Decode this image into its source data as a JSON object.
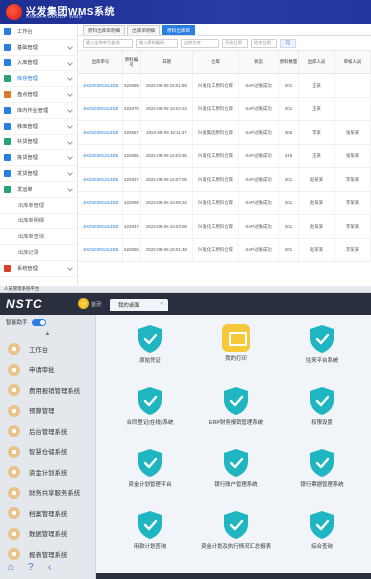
{
  "top": {
    "logo_title": "兴发集团WMS系统",
    "logo_sub": "XINGFA GROUP WMS",
    "sidebar": [
      {
        "label": "工作台",
        "color": "#2a7de1",
        "arrow": false
      },
      {
        "label": "基础管理",
        "color": "#2a7de1",
        "arrow": true
      },
      {
        "label": "入库管理",
        "color": "#2a7de1",
        "arrow": true
      },
      {
        "label": "库存管理",
        "color": "#27a37b",
        "arrow": true,
        "active": true
      },
      {
        "label": "盘点管理",
        "color": "#d87a2a",
        "arrow": true
      },
      {
        "label": "库内作业管理",
        "color": "#2a7de1",
        "arrow": true
      },
      {
        "label": "移库管理",
        "color": "#2a7de1",
        "arrow": true
      },
      {
        "label": "补货管理",
        "color": "#27a37b",
        "arrow": true
      },
      {
        "label": "拣货管理",
        "color": "#2a7de1",
        "arrow": true
      },
      {
        "label": "发货管理",
        "color": "#2a7de1",
        "arrow": true
      },
      {
        "label": "发运单",
        "color": "#27a37b",
        "arrow": true
      },
      {
        "label": "出库单管理",
        "color": "",
        "sub": true
      },
      {
        "label": "出库单明细",
        "color": "",
        "sub": true
      },
      {
        "label": "出库单查询",
        "color": "",
        "sub": true
      },
      {
        "label": "出库记录",
        "color": "",
        "sub": true
      },
      {
        "label": "系统管理",
        "color": "#d8402a",
        "arrow": true
      }
    ],
    "tabs": [
      "原料出库单明细",
      "出库单明细",
      "原料出库单"
    ],
    "filters": [
      "输入出库单号查询",
      "输入原料编码",
      "出库仓库",
      "开始日期",
      "结束日期"
    ],
    "filter_button": "Q",
    "columns": [
      "出库单号",
      "原料编号",
      "日期",
      "仓库",
      "状态",
      "原料数量",
      "出库人员",
      "审核人员"
    ],
    "rows": [
      {
        "no": "JH2020091314EB",
        "code": "522859",
        "date": "2022-09-09 16:01:58",
        "wh": "兴发化工原料仓库",
        "status": "SAP过账成功",
        "qty": "201",
        "user": "王某",
        "checker": ""
      },
      {
        "no": "JH2020091314EB",
        "code": "522870",
        "date": "2022-09-09 16:02:24",
        "wh": "兴发化工原料仓库",
        "status": "SAP过账成功",
        "qty": "201",
        "user": "王某",
        "checker": ""
      },
      {
        "no": "JH2020091314EB",
        "code": "522867",
        "date": "2022-09-09 16:11:37",
        "wh": "兴发集团原料仓库",
        "status": "SAP过账成功",
        "qty": "306",
        "user": "李某",
        "checker": "张某某"
      },
      {
        "no": "JH2020091314EB",
        "code": "522855",
        "date": "2022-09-09 16:03:35",
        "wh": "兴发化工原料仓库",
        "status": "SAP过账成功",
        "qty": "319",
        "user": "王某",
        "checker": "张某某"
      },
      {
        "no": "JH2020091314EB",
        "code": "522847",
        "date": "2022-09-09 16:07:08",
        "wh": "兴发化工原料仓库",
        "status": "SAP过账成功",
        "qty": "201",
        "user": "赵某某",
        "checker": "李某某"
      },
      {
        "no": "JH2020091314EB",
        "code": "522859",
        "date": "2022-09-09 16:09:32",
        "wh": "兴发化工原料仓库",
        "status": "SAP过账成功",
        "qty": "201",
        "user": "赵某某",
        "checker": "李某某"
      },
      {
        "no": "JH2020091314EB",
        "code": "522847",
        "date": "2022-09-09 16:03:08",
        "wh": "兴发化工原料仓库",
        "status": "SAP过账成功",
        "qty": "201",
        "user": "赵某某",
        "checker": "李某某"
      },
      {
        "no": "JH2020091314EB",
        "code": "522850",
        "date": "2022-09-09 16:01:48",
        "wh": "兴发化工原料仓库",
        "status": "SAP过账成功",
        "qty": "201",
        "user": "赵某某",
        "checker": "李某某"
      }
    ]
  },
  "bottom": {
    "window_title": "人员管理系统平台",
    "brand": "NSTC",
    "home_label": "首页",
    "active_tab": "我的桌面",
    "toggle_label": "智能助手",
    "menu": [
      "工作台",
      "申请审批",
      "费用报销管理系统",
      "预算管理",
      "后台管理系统",
      "智慧仓储系统",
      "资金计划系统",
      "财务共享服务系统",
      "档案管理系统",
      "数据管理系统",
      "报表管理系统"
    ],
    "cards": [
      {
        "label": "原始凭证",
        "kind": "shield"
      },
      {
        "label": "我的打印",
        "kind": "yellow"
      },
      {
        "label": "往来平台系统",
        "kind": "shield"
      },
      {
        "label": "合同登记(在线)系统",
        "kind": "shield"
      },
      {
        "label": "ERP财务报销管理系统",
        "kind": "shield"
      },
      {
        "label": "权限设置",
        "kind": "shield"
      },
      {
        "label": "资金计划管理平台",
        "kind": "shield"
      },
      {
        "label": "银行账户管理系统",
        "kind": "shield"
      },
      {
        "label": "银行票据管理系统",
        "kind": "shield"
      },
      {
        "label": "用款计划查询",
        "kind": "shield"
      },
      {
        "label": "资金计划及执行情况汇总报表",
        "kind": "shield"
      },
      {
        "label": "综合查询",
        "kind": "shield"
      }
    ]
  }
}
